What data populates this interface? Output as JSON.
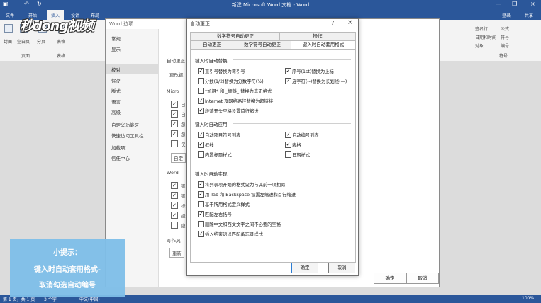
{
  "app": {
    "title": "新建 Microsoft Word 文档 - Word",
    "tabs": [
      "文件",
      "开始",
      "插入",
      "设计",
      "布局"
    ],
    "active_tab": "插入",
    "login": "登录",
    "share": "共享",
    "ribbon_labels": {
      "pages": "页面",
      "tables": "表格",
      "cover": "封面",
      "blank": "空白页",
      "break": "分页",
      "table": "表格",
      "header": "页眉",
      "footer": "页脚",
      "signature": "签名行",
      "datetime": "日期和时间",
      "object": "对象",
      "formula": "公式",
      "symbol": "符号",
      "number": "编号",
      "symbols_group": "符号"
    }
  },
  "options_dialog": {
    "title": "Word 选项",
    "nav": [
      "常规",
      "显示",
      "校对",
      "保存",
      "版式",
      "语言",
      "高级",
      "自定义功能区",
      "快速访问工具栏",
      "加载项",
      "信任中心"
    ],
    "selected_nav": "校对",
    "headers": [
      "自动更正",
      "Micro",
      "Word"
    ],
    "text_bits": [
      "更改键",
      "日",
      "自",
      "忽",
      "忽",
      "仅",
      "自定",
      "键",
      "键",
      "标",
      "经",
      "隐",
      "显",
      "写作风",
      "重新"
    ],
    "ok": "确定",
    "cancel": "取消"
  },
  "autocorrect": {
    "title": "自动更正",
    "help": "?",
    "close": "×",
    "tabs_row1": [
      "数学符号自动更正",
      "操作"
    ],
    "tabs_row2": [
      "自动更正",
      "数学符号自动更正",
      "键入时自动套用格式"
    ],
    "selected_tab": "键入时自动套用格式",
    "section1": {
      "title": "键入时自动替换",
      "items": [
        {
          "label": "直引号替换为弯引号",
          "checked": true
        },
        {
          "label": "序号(1st)替换为上标",
          "checked": true
        },
        {
          "label": "分数(1/2)替换为分数字符(½)",
          "checked": false
        },
        {
          "label": "连字符(--)替换为长划线(—)",
          "checked": true
        },
        {
          "label": "*加粗* 和 _倾斜_ 替换为真正格式",
          "checked": false
        },
        {
          "label": "Internet 及网络路径替换为超链接",
          "checked": true
        },
        {
          "label": "段落开头空格设置首行缩进",
          "checked": true
        }
      ]
    },
    "section2": {
      "title": "键入时自动应用",
      "items": [
        {
          "label": "自动项目符号列表",
          "checked": true
        },
        {
          "label": "自动编号列表",
          "checked": true
        },
        {
          "label": "框线",
          "checked": true
        },
        {
          "label": "表格",
          "checked": true
        },
        {
          "label": "内置标题样式",
          "checked": false
        },
        {
          "label": "日期样式",
          "checked": false
        }
      ]
    },
    "section3": {
      "title": "键入时自动实现",
      "items": [
        {
          "label": "将列表项开始的格式设为与其前一项相似",
          "checked": true
        },
        {
          "label": "用 Tab 和 Backspace 设置左缩进和首行缩进",
          "checked": true
        },
        {
          "label": "基于所用格式定义样式",
          "checked": false
        },
        {
          "label": "匹配左右括号",
          "checked": true
        },
        {
          "label": "删除中文和西文文字之间不必要的空格",
          "checked": false
        },
        {
          "label": "插入结束语以匹配备忘录样式",
          "checked": true
        }
      ]
    },
    "ok": "确定",
    "cancel": "取消"
  },
  "status": {
    "page": "第 1 页，共 1 页",
    "words": "3 个字",
    "language": "中文(中国)",
    "zoom": "100%"
  },
  "watermark": "秒dong视频",
  "tip": {
    "heading": "小提示：",
    "line1": "键入时自动套用格式-",
    "line2": "取消勾选自动编号"
  },
  "colors": {
    "word_blue": "#2b579a",
    "tip_blue": "#7fbfe9"
  }
}
